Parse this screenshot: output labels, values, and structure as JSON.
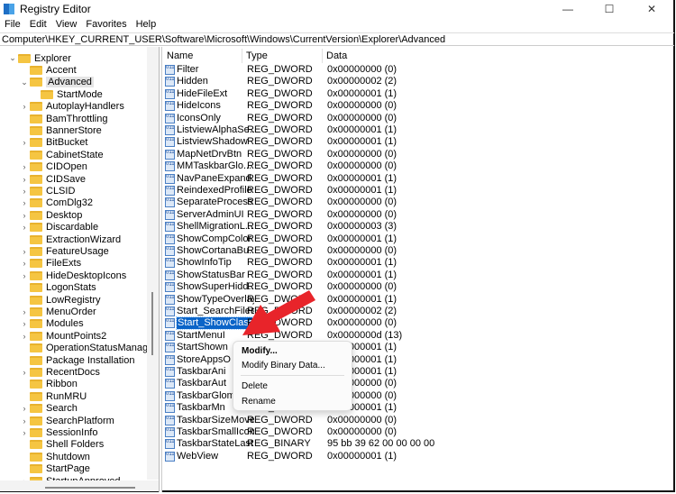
{
  "window": {
    "title": "Registry Editor",
    "minimize": "—",
    "maximize": "☐",
    "close": "✕"
  },
  "menu": [
    "File",
    "Edit",
    "View",
    "Favorites",
    "Help"
  ],
  "address": "Computer\\HKEY_CURRENT_USER\\Software\\Microsoft\\Windows\\CurrentVersion\\Explorer\\Advanced",
  "tree": [
    {
      "label": "Explorer",
      "level": 0,
      "chevron": "expanded"
    },
    {
      "label": "Accent",
      "level": 1,
      "chevron": "none"
    },
    {
      "label": "Advanced",
      "level": 1,
      "chevron": "expanded",
      "selected": true
    },
    {
      "label": "StartMode",
      "level": 2,
      "chevron": "none"
    },
    {
      "label": "AutoplayHandlers",
      "level": 1,
      "chevron": "collapsed"
    },
    {
      "label": "BamThrottling",
      "level": 1,
      "chevron": "none"
    },
    {
      "label": "BannerStore",
      "level": 1,
      "chevron": "none"
    },
    {
      "label": "BitBucket",
      "level": 1,
      "chevron": "collapsed"
    },
    {
      "label": "CabinetState",
      "level": 1,
      "chevron": "none"
    },
    {
      "label": "CIDOpen",
      "level": 1,
      "chevron": "collapsed"
    },
    {
      "label": "CIDSave",
      "level": 1,
      "chevron": "collapsed"
    },
    {
      "label": "CLSID",
      "level": 1,
      "chevron": "collapsed"
    },
    {
      "label": "ComDlg32",
      "level": 1,
      "chevron": "collapsed"
    },
    {
      "label": "Desktop",
      "level": 1,
      "chevron": "collapsed"
    },
    {
      "label": "Discardable",
      "level": 1,
      "chevron": "collapsed"
    },
    {
      "label": "ExtractionWizard",
      "level": 1,
      "chevron": "none"
    },
    {
      "label": "FeatureUsage",
      "level": 1,
      "chevron": "collapsed"
    },
    {
      "label": "FileExts",
      "level": 1,
      "chevron": "collapsed"
    },
    {
      "label": "HideDesktopIcons",
      "level": 1,
      "chevron": "collapsed"
    },
    {
      "label": "LogonStats",
      "level": 1,
      "chevron": "none"
    },
    {
      "label": "LowRegistry",
      "level": 1,
      "chevron": "none"
    },
    {
      "label": "MenuOrder",
      "level": 1,
      "chevron": "collapsed"
    },
    {
      "label": "Modules",
      "level": 1,
      "chevron": "collapsed"
    },
    {
      "label": "MountPoints2",
      "level": 1,
      "chevron": "collapsed"
    },
    {
      "label": "OperationStatusManager",
      "level": 1,
      "chevron": "none"
    },
    {
      "label": "Package Installation",
      "level": 1,
      "chevron": "none"
    },
    {
      "label": "RecentDocs",
      "level": 1,
      "chevron": "collapsed"
    },
    {
      "label": "Ribbon",
      "level": 1,
      "chevron": "none"
    },
    {
      "label": "RunMRU",
      "level": 1,
      "chevron": "none"
    },
    {
      "label": "Search",
      "level": 1,
      "chevron": "collapsed"
    },
    {
      "label": "SearchPlatform",
      "level": 1,
      "chevron": "collapsed"
    },
    {
      "label": "SessionInfo",
      "level": 1,
      "chevron": "collapsed"
    },
    {
      "label": "Shell Folders",
      "level": 1,
      "chevron": "none"
    },
    {
      "label": "Shutdown",
      "level": 1,
      "chevron": "none"
    },
    {
      "label": "StartPage",
      "level": 1,
      "chevron": "none"
    },
    {
      "label": "StartupApproved",
      "level": 1,
      "chevron": "collapsed"
    }
  ],
  "columns": {
    "name": "Name",
    "type": "Type",
    "data": "Data"
  },
  "values": [
    {
      "name": "Filter",
      "type": "REG_DWORD",
      "data": "0x00000000 (0)"
    },
    {
      "name": "Hidden",
      "type": "REG_DWORD",
      "data": "0x00000002 (2)"
    },
    {
      "name": "HideFileExt",
      "type": "REG_DWORD",
      "data": "0x00000001 (1)"
    },
    {
      "name": "HideIcons",
      "type": "REG_DWORD",
      "data": "0x00000000 (0)"
    },
    {
      "name": "IconsOnly",
      "type": "REG_DWORD",
      "data": "0x00000000 (0)"
    },
    {
      "name": "ListviewAlphaSe...",
      "type": "REG_DWORD",
      "data": "0x00000001 (1)"
    },
    {
      "name": "ListviewShadow",
      "type": "REG_DWORD",
      "data": "0x00000001 (1)"
    },
    {
      "name": "MapNetDrvBtn",
      "type": "REG_DWORD",
      "data": "0x00000000 (0)"
    },
    {
      "name": "MMTaskbarGlo...",
      "type": "REG_DWORD",
      "data": "0x00000000 (0)"
    },
    {
      "name": "NavPaneExpand...",
      "type": "REG_DWORD",
      "data": "0x00000001 (1)"
    },
    {
      "name": "ReindexedProfile",
      "type": "REG_DWORD",
      "data": "0x00000001 (1)"
    },
    {
      "name": "SeparateProcess",
      "type": "REG_DWORD",
      "data": "0x00000000 (0)"
    },
    {
      "name": "ServerAdminUI",
      "type": "REG_DWORD",
      "data": "0x00000000 (0)"
    },
    {
      "name": "ShellMigrationL...",
      "type": "REG_DWORD",
      "data": "0x00000003 (3)"
    },
    {
      "name": "ShowCompColor",
      "type": "REG_DWORD",
      "data": "0x00000001 (1)"
    },
    {
      "name": "ShowCortanaBu...",
      "type": "REG_DWORD",
      "data": "0x00000000 (0)"
    },
    {
      "name": "ShowInfoTip",
      "type": "REG_DWORD",
      "data": "0x00000001 (1)"
    },
    {
      "name": "ShowStatusBar",
      "type": "REG_DWORD",
      "data": "0x00000001 (1)"
    },
    {
      "name": "ShowSuperHidd...",
      "type": "REG_DWORD",
      "data": "0x00000000 (0)"
    },
    {
      "name": "ShowTypeOverlay",
      "type": "REG_DWORD",
      "data": "0x00000001 (1)"
    },
    {
      "name": "Start_SearchFiles",
      "type": "REG_DWORD",
      "data": "0x00000002 (2)"
    },
    {
      "name": "Start_ShowClass...",
      "type": "REG_DWORD",
      "data": "0x00000000 (0)",
      "selected": true
    },
    {
      "name": "StartMenuI",
      "type": "REG_DWORD",
      "data": "0x0000000d (13)"
    },
    {
      "name": "StartShown",
      "type": "REG_DWORD",
      "data": "0x00000001 (1)"
    },
    {
      "name": "StoreAppsO",
      "type": "REG_DWORD",
      "data": "0x00000001 (1)"
    },
    {
      "name": "TaskbarAni",
      "type": "REG_DWORD",
      "data": "0x00000001 (1)"
    },
    {
      "name": "TaskbarAut",
      "type": "REG_DWORD",
      "data": "0x00000000 (0)"
    },
    {
      "name": "TaskbarGlomLevel",
      "type": "REG_DWORD",
      "data": "0x00000000 (0)"
    },
    {
      "name": "TaskbarMn",
      "type": "REG_DWORD",
      "data": "0x00000001 (1)"
    },
    {
      "name": "TaskbarSizeMove",
      "type": "REG_DWORD",
      "data": "0x00000000 (0)"
    },
    {
      "name": "TaskbarSmallIcons",
      "type": "REG_DWORD",
      "data": "0x00000000 (0)"
    },
    {
      "name": "TaskbarStateLast...",
      "type": "REG_BINARY",
      "data": "95 bb 39 62 00 00 00 00"
    },
    {
      "name": "WebView",
      "type": "REG_DWORD",
      "data": "0x00000001 (1)"
    }
  ],
  "context_menu": {
    "modify": "Modify...",
    "modify_binary": "Modify Binary Data...",
    "delete": "Delete",
    "rename": "Rename"
  },
  "colors": {
    "selection": "#0a64c8",
    "arrow": "#e8242a",
    "folder": "#f5c542"
  }
}
